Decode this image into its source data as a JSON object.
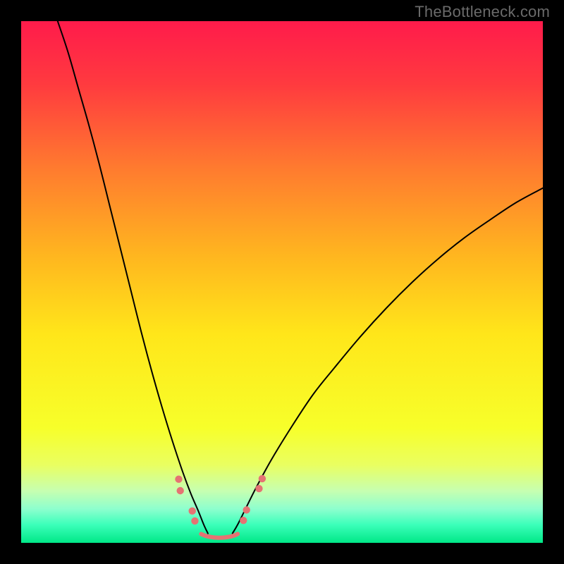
{
  "watermark": "TheBottleneck.com",
  "chart_data": {
    "type": "line",
    "title": "",
    "xlabel": "",
    "ylabel": "",
    "xlim": [
      0,
      100
    ],
    "ylim": [
      0,
      100
    ],
    "grid": false,
    "background_gradient": {
      "stops": [
        {
          "offset": 0.0,
          "color": "#ff1b4b"
        },
        {
          "offset": 0.12,
          "color": "#ff3a3f"
        },
        {
          "offset": 0.28,
          "color": "#ff7a2f"
        },
        {
          "offset": 0.45,
          "color": "#ffb61f"
        },
        {
          "offset": 0.6,
          "color": "#ffe61a"
        },
        {
          "offset": 0.78,
          "color": "#f7ff2a"
        },
        {
          "offset": 0.85,
          "color": "#eaff60"
        },
        {
          "offset": 0.9,
          "color": "#c7ffb0"
        },
        {
          "offset": 0.935,
          "color": "#8dffce"
        },
        {
          "offset": 0.965,
          "color": "#3cffba"
        },
        {
          "offset": 1.0,
          "color": "#00e887"
        }
      ]
    },
    "series": [
      {
        "name": "left-branch",
        "color": "#000000",
        "stroke_width": 2,
        "x": [
          7.0,
          9.0,
          11.0,
          13.0,
          15.0,
          17.0,
          19.0,
          21.0,
          23.0,
          25.0,
          27.0,
          29.0,
          31.0,
          32.5,
          34.0,
          35.0,
          35.8
        ],
        "y": [
          100.0,
          94.0,
          87.0,
          80.0,
          72.5,
          64.5,
          56.5,
          48.5,
          40.5,
          33.0,
          26.0,
          19.5,
          13.5,
          9.5,
          6.0,
          3.5,
          1.8
        ]
      },
      {
        "name": "right-branch",
        "color": "#000000",
        "stroke_width": 2,
        "x": [
          40.5,
          41.5,
          43.0,
          45.0,
          48.0,
          52.0,
          56.0,
          60.0,
          65.0,
          70.0,
          75.0,
          80.0,
          85.0,
          90.0,
          95.0,
          100.0
        ],
        "y": [
          1.8,
          3.5,
          6.5,
          10.5,
          16.0,
          22.5,
          28.5,
          33.5,
          39.5,
          45.0,
          50.0,
          54.5,
          58.5,
          62.0,
          65.3,
          68.0
        ]
      },
      {
        "name": "bottom-flat",
        "color": "#e57373",
        "stroke_width": 6,
        "x": [
          34.5,
          35.5,
          36.5,
          37.5,
          38.5,
          39.5,
          40.5,
          41.5
        ],
        "y": [
          1.7,
          1.3,
          1.1,
          1.0,
          1.0,
          1.1,
          1.3,
          1.7
        ]
      }
    ],
    "markers": [
      {
        "name": "left-dot-upper-a",
        "x": 30.2,
        "y": 12.2,
        "r": 5.2,
        "color": "#e57373"
      },
      {
        "name": "left-dot-upper-b",
        "x": 30.5,
        "y": 10.0,
        "r": 5.2,
        "color": "#e57373"
      },
      {
        "name": "left-dot-lower-a",
        "x": 32.8,
        "y": 6.1,
        "r": 5.2,
        "color": "#e57373"
      },
      {
        "name": "left-dot-lower-b",
        "x": 33.3,
        "y": 4.2,
        "r": 5.2,
        "color": "#e57373"
      },
      {
        "name": "right-dot-lower-a",
        "x": 42.6,
        "y": 4.3,
        "r": 5.2,
        "color": "#e57373"
      },
      {
        "name": "right-dot-lower-b",
        "x": 43.2,
        "y": 6.3,
        "r": 5.2,
        "color": "#e57373"
      },
      {
        "name": "right-dot-upper-a",
        "x": 45.6,
        "y": 10.4,
        "r": 5.2,
        "color": "#e57373"
      },
      {
        "name": "right-dot-upper-b",
        "x": 46.2,
        "y": 12.3,
        "r": 5.2,
        "color": "#e57373"
      }
    ]
  }
}
